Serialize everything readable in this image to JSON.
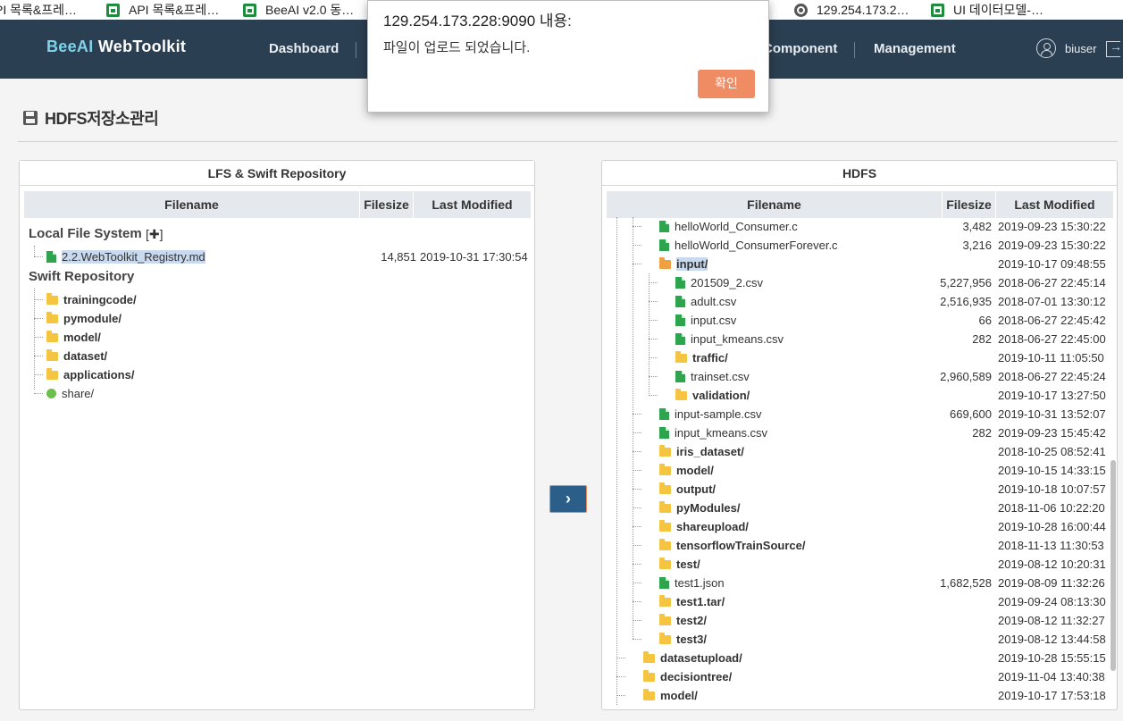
{
  "bookmarks": [
    {
      "label": "PI 목록&프레…",
      "icon": "sheet"
    },
    {
      "label": "API 목록&프레…",
      "icon": "sheet"
    },
    {
      "label": "BeeAI v2.0 동…",
      "icon": "sheet"
    },
    {
      "label": "129.254.173.2…",
      "icon": "globe"
    },
    {
      "label": "UI 데이터모델-…",
      "icon": "sheet"
    }
  ],
  "header": {
    "logo_bee": "BeeAI",
    "logo_rest": " WebToolkit",
    "nav": [
      "Dashboard",
      "Component",
      "Management"
    ],
    "username": "biuser"
  },
  "page": {
    "title": "HDFS저장소관리"
  },
  "lfs": {
    "title": "LFS & Swift Repository",
    "columns": [
      "Filename",
      "Filesize",
      "Last Modified"
    ],
    "local_label": "Local File System",
    "add_label": "[✚]",
    "local_files": [
      {
        "name": "2.2.WebToolkit_Registry.md",
        "size": "14,851",
        "modified": "2019-10-31 17:30:54",
        "selected": true
      }
    ],
    "swift_label": "Swift Repository",
    "swift_items": [
      {
        "name": "trainingcode/",
        "type": "folder"
      },
      {
        "name": "pymodule/",
        "type": "folder"
      },
      {
        "name": "model/",
        "type": "folder"
      },
      {
        "name": "dataset/",
        "type": "folder"
      },
      {
        "name": "applications/",
        "type": "folder"
      },
      {
        "name": "share/",
        "type": "shared"
      }
    ]
  },
  "move_button": "›",
  "hdfs": {
    "title": "HDFS",
    "columns": [
      "Filename",
      "Filesize",
      "Last Modified"
    ],
    "rows": [
      {
        "name": "helloWorld_Consumer.c",
        "type": "file",
        "depth": 1,
        "size": "3,482",
        "modified": "2019-09-23 15:30:22"
      },
      {
        "name": "helloWorld_ConsumerForever.c",
        "type": "file",
        "depth": 1,
        "size": "3,216",
        "modified": "2019-09-23 15:30:22"
      },
      {
        "name": "input/",
        "type": "open-folder",
        "depth": 1,
        "size": "",
        "modified": "2019-10-17 09:48:55",
        "selected": true
      },
      {
        "name": "201509_2.csv",
        "type": "file",
        "depth": 2,
        "size": "5,227,956",
        "modified": "2018-06-27 22:45:14"
      },
      {
        "name": "adult.csv",
        "type": "file",
        "depth": 2,
        "size": "2,516,935",
        "modified": "2018-07-01 13:30:12"
      },
      {
        "name": "input.csv",
        "type": "file",
        "depth": 2,
        "size": "66",
        "modified": "2018-06-27 22:45:42"
      },
      {
        "name": "input_kmeans.csv",
        "type": "file",
        "depth": 2,
        "size": "282",
        "modified": "2018-06-27 22:45:00"
      },
      {
        "name": "traffic/",
        "type": "folder",
        "depth": 2,
        "size": "",
        "modified": "2019-10-11 11:05:50"
      },
      {
        "name": "trainset.csv",
        "type": "file",
        "depth": 2,
        "size": "2,960,589",
        "modified": "2018-06-27 22:45:24"
      },
      {
        "name": "validation/",
        "type": "folder",
        "depth": 2,
        "size": "",
        "modified": "2019-10-17 13:27:50"
      },
      {
        "name": "input-sample.csv",
        "type": "file",
        "depth": 1,
        "size": "669,600",
        "modified": "2019-10-31 13:52:07"
      },
      {
        "name": "input_kmeans.csv",
        "type": "file",
        "depth": 1,
        "size": "282",
        "modified": "2019-09-23 15:45:42"
      },
      {
        "name": "iris_dataset/",
        "type": "folder",
        "depth": 1,
        "size": "",
        "modified": "2018-10-25 08:52:41"
      },
      {
        "name": "model/",
        "type": "folder",
        "depth": 1,
        "size": "",
        "modified": "2019-10-15 14:33:15"
      },
      {
        "name": "output/",
        "type": "folder",
        "depth": 1,
        "size": "",
        "modified": "2019-10-18 10:07:57"
      },
      {
        "name": "pyModules/",
        "type": "folder",
        "depth": 1,
        "size": "",
        "modified": "2018-11-06 10:22:20"
      },
      {
        "name": "shareupload/",
        "type": "folder",
        "depth": 1,
        "size": "",
        "modified": "2019-10-28 16:00:44"
      },
      {
        "name": "tensorflowTrainSource/",
        "type": "folder",
        "depth": 1,
        "size": "",
        "modified": "2018-11-13 11:30:53"
      },
      {
        "name": "test/",
        "type": "folder",
        "depth": 1,
        "size": "",
        "modified": "2019-08-12 10:20:31"
      },
      {
        "name": "test1.json",
        "type": "file",
        "depth": 1,
        "size": "1,682,528",
        "modified": "2019-08-09 11:32:26"
      },
      {
        "name": "test1.tar/",
        "type": "folder",
        "depth": 1,
        "size": "",
        "modified": "2019-09-24 08:13:30"
      },
      {
        "name": "test2/",
        "type": "folder",
        "depth": 1,
        "size": "",
        "modified": "2019-08-12 11:32:27"
      },
      {
        "name": "test3/",
        "type": "folder",
        "depth": 1,
        "size": "",
        "modified": "2019-08-12 13:44:58"
      },
      {
        "name": "datasetupload/",
        "type": "folder",
        "depth": 0,
        "size": "",
        "modified": "2019-10-28 15:55:15"
      },
      {
        "name": "decisiontree/",
        "type": "folder",
        "depth": 0,
        "size": "",
        "modified": "2019-11-04 13:40:38"
      },
      {
        "name": "model/",
        "type": "folder",
        "depth": 0,
        "size": "",
        "modified": "2019-10-17 17:53:18"
      }
    ]
  },
  "dialog": {
    "title": "129.254.173.228:9090 내용:",
    "message": "파일이 업로드 되었습니다.",
    "ok": "확인"
  }
}
